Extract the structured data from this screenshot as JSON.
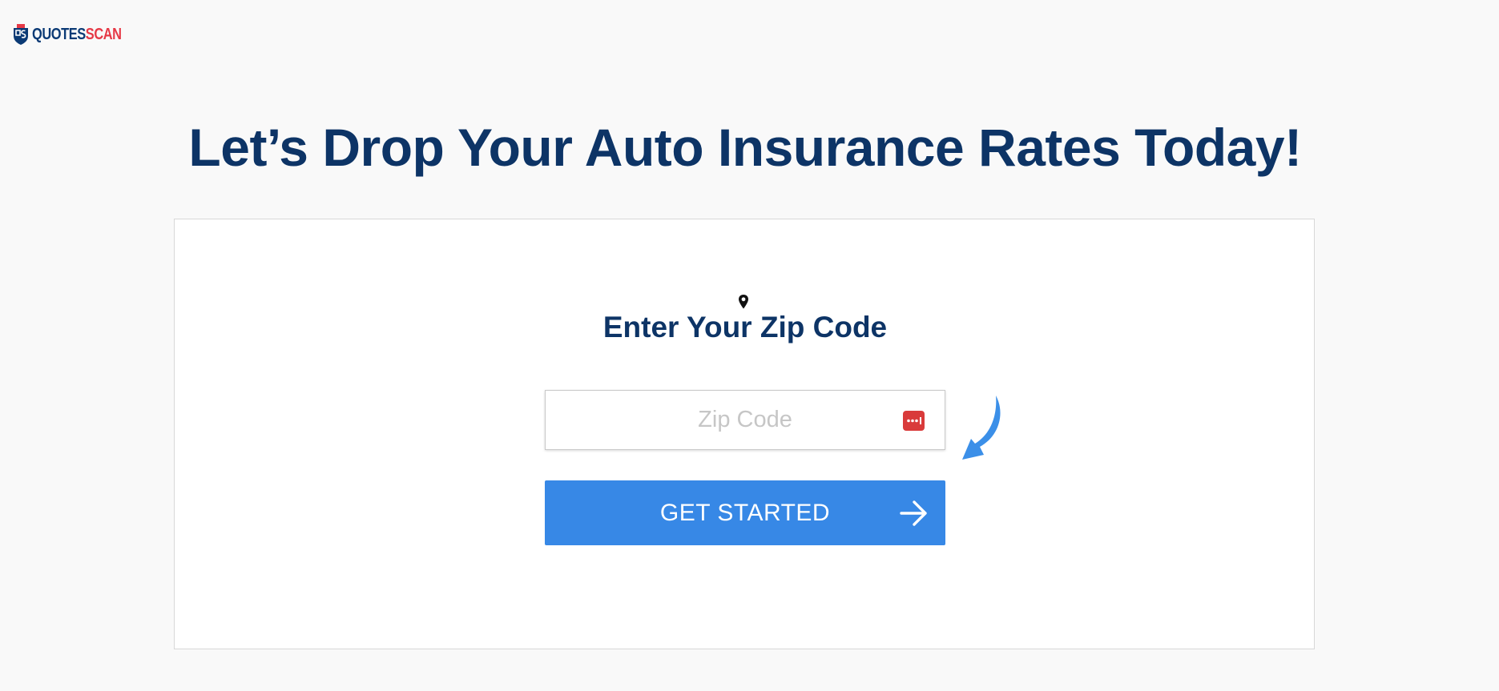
{
  "logo": {
    "part1": "QUOTES",
    "part2": "SCAN",
    "icon": "shield-logo-icon",
    "colors": {
      "primary": "#0b3a75",
      "accent": "#e63946"
    }
  },
  "headline": "Let’s Drop Your Auto Insurance Rates Today!",
  "form": {
    "title": "Enter Your Zip Code",
    "title_icon": "map-pin-icon",
    "zip": {
      "placeholder": "Zip Code",
      "value": ""
    },
    "autofill_icon": "password-manager-icon",
    "hint_icon": "curved-arrow-icon",
    "cta_label": "GET STARTED",
    "cta_icon": "arrow-right-icon"
  },
  "colors": {
    "headline": "#0d3466",
    "button": "#3788e6",
    "background": "#f9f9f9",
    "card": "#ffffff"
  }
}
